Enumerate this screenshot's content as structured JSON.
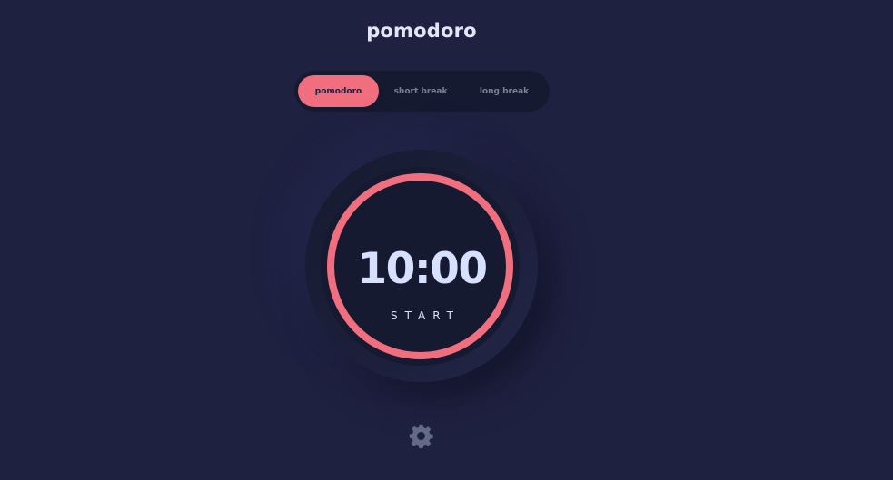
{
  "app": {
    "title": "pomodoro"
  },
  "modes": [
    {
      "label": "pomodoro",
      "active": true
    },
    {
      "label": "short break",
      "active": false
    },
    {
      "label": "long break",
      "active": false
    }
  ],
  "timer": {
    "time": "10:00",
    "action_label": "START",
    "progress": 1.0
  },
  "icons": {
    "settings": "gear-icon"
  },
  "colors": {
    "background": "#1f2141",
    "accent": "#f06e7e",
    "dial": "#151a30",
    "text": "#d7e0fe",
    "muted": "#7a7e98"
  }
}
